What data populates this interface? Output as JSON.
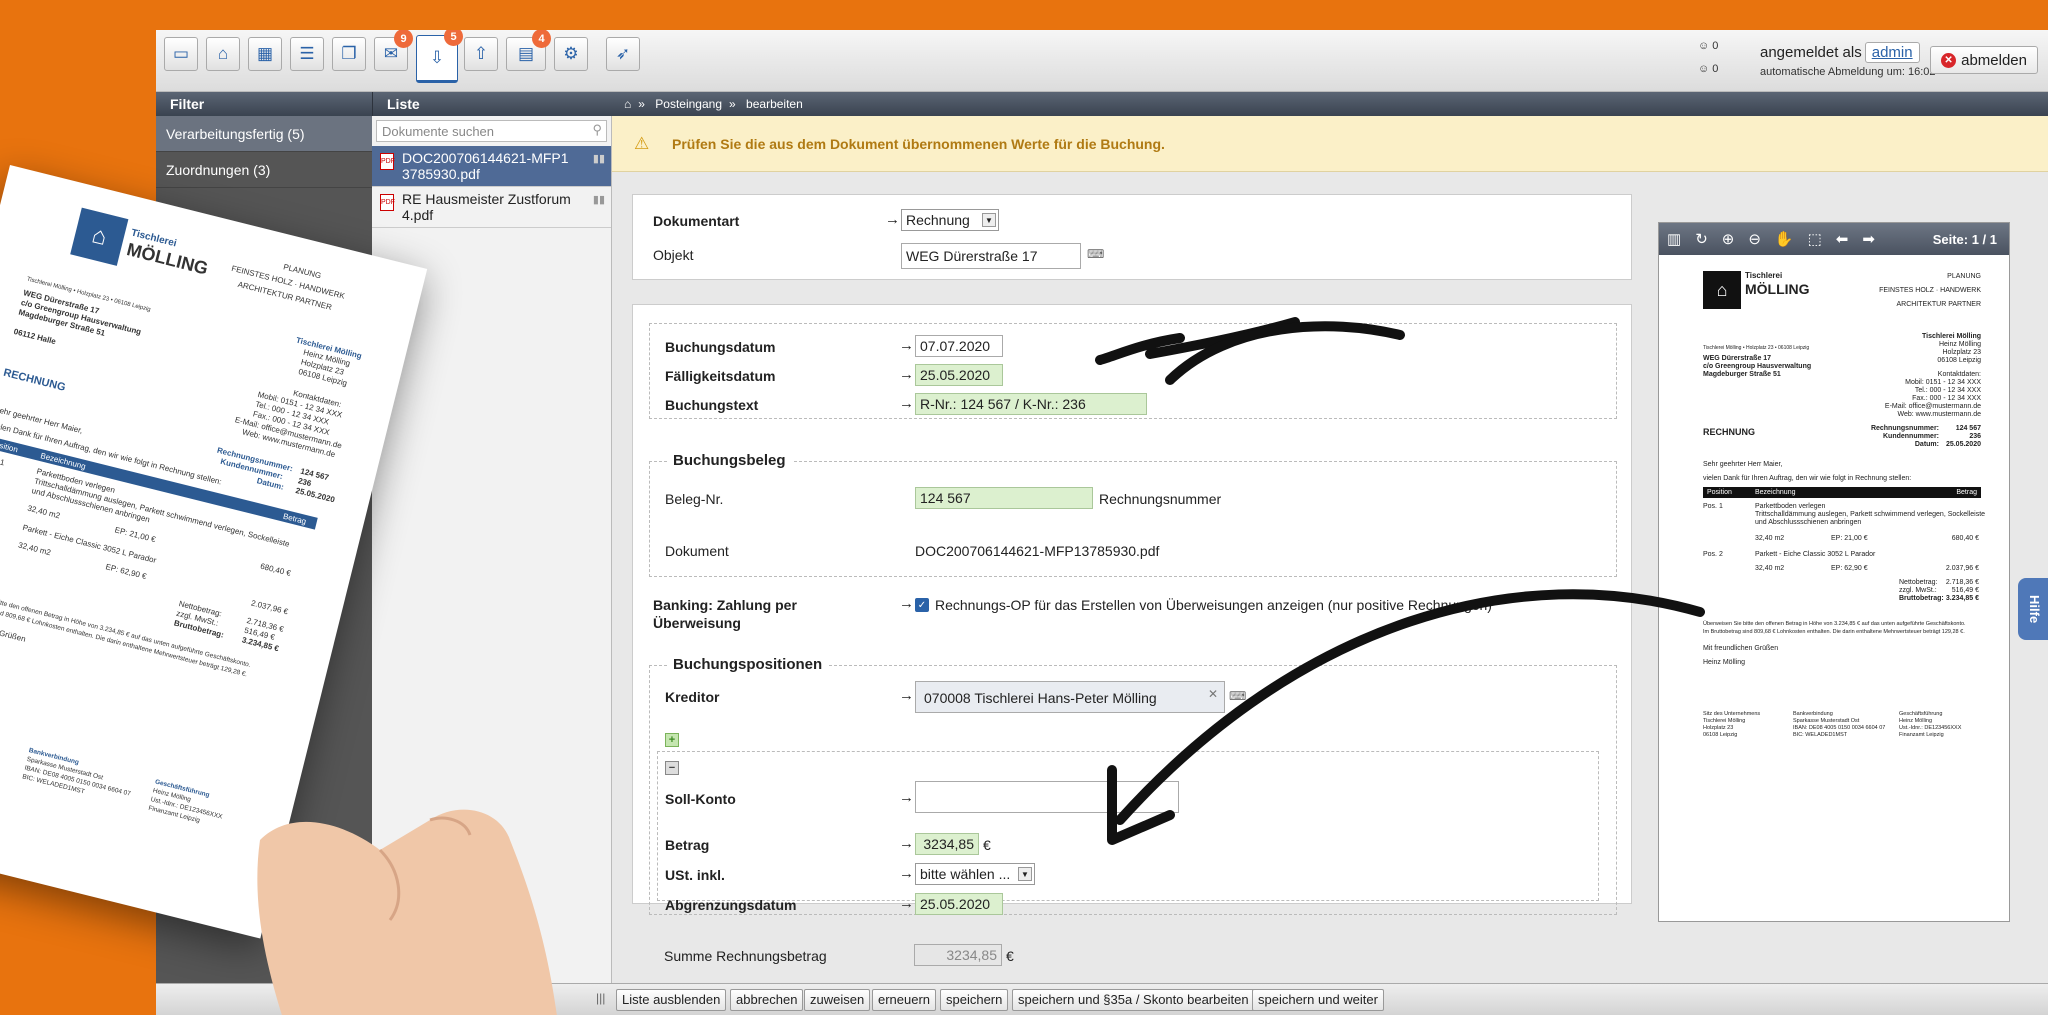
{
  "toolbar": {
    "buttons": [
      {
        "icon": "card-icon",
        "badge": ""
      },
      {
        "icon": "home-icon",
        "badge": ""
      },
      {
        "icon": "calendar-icon",
        "badge": ""
      },
      {
        "icon": "list-icon",
        "badge": ""
      },
      {
        "icon": "documents-icon",
        "badge": ""
      },
      {
        "icon": "mail-icon",
        "badge": "9"
      },
      {
        "icon": "inbox-icon",
        "badge": "5"
      },
      {
        "icon": "outbox-icon",
        "badge": "4"
      },
      {
        "icon": "ticket-icon",
        "badge": ""
      },
      {
        "icon": "gear-icon",
        "badge": ""
      },
      {
        "icon": "rocket-icon",
        "badge": ""
      }
    ],
    "user": {
      "count1": "0",
      "count2": "0",
      "logged_in_as": "angemeldet als",
      "username": "admin",
      "auto_logout": "automatische Abmeldung um: 16:02",
      "logout_label": "abmelden"
    }
  },
  "filter": {
    "title": "Filter",
    "items": [
      "Verarbeitungsfertig (5)",
      "Zuordnungen (3)",
      "",
      ""
    ]
  },
  "list": {
    "title": "Liste",
    "search_placeholder": "Dokumente suchen",
    "items": [
      {
        "name": "DOC200706144621-MFP13785930.pdf",
        "selected": true
      },
      {
        "name": "RE Hausmeister Zustforum 4.pdf",
        "selected": false
      }
    ]
  },
  "breadcrumb": [
    "Posteingang",
    "bearbeiten"
  ],
  "alert": "Prüfen Sie die aus dem Dokument übernommenen Werte für die Buchung.",
  "form": {
    "dokumentart_label": "Dokumentart",
    "dokumentart_value": "Rechnung",
    "objekt_label": "Objekt",
    "objekt_value": "WEG Dürerstraße 17",
    "buchungsdatum_label": "Buchungsdatum",
    "buchungsdatum_value": "07.07.2020",
    "faelligkeit_label": "Fälligkeitsdatum",
    "faelligkeit_value": "25.05.2020",
    "buchungstext_label": "Buchungstext",
    "buchungstext_value": "R-Nr.: 124 567 / K-Nr.: 236",
    "beleg_title": "Buchungsbeleg",
    "beleg_nr_label": "Beleg-Nr.",
    "beleg_nr_value": "124 567",
    "beleg_nr_hint": "Rechnungsnummer",
    "dokument_label": "Dokument",
    "dokument_value": "DOC200706144621-MFP13785930.pdf",
    "banking_label": "Banking: Zahlung per Überweisung",
    "banking_text": "Rechnungs-OP für das Erstellen von Überweisungen anzeigen (nur positive Rechnungen)",
    "positionen_title": "Buchungspositionen",
    "kreditor_label": "Kreditor",
    "kreditor_value": "070008 Tischlerei Hans-Peter Mölling",
    "soll_label": "Soll-Konto",
    "soll_value": "",
    "betrag_label": "Betrag",
    "betrag_value": "3234,85",
    "currency": "€",
    "ust_label": "USt. inkl.",
    "ust_value": "bitte wählen ...",
    "abgrenzung_label": "Abgrenzungsdatum",
    "abgrenzung_value": "25.05.2020",
    "summe_label": "Summe Rechnungsbetrag",
    "summe_value": "3234,85"
  },
  "pdf": {
    "page": "Seite: 1 / 1",
    "company_top": "Tischlerei",
    "company": "MÖLLING",
    "tagline1": "PLANUNG",
    "tagline2": "FEINSTES HOLZ · HANDWERK",
    "tagline3": "ARCHITEKTUR PARTNER",
    "sender_line": "Tischlerei Mölling • Holzplatz 23 • 06108 Leipzig",
    "recipient1": "WEG Dürerstraße 17",
    "recipient2": "c/o Greengroup Hausverwaltung",
    "recipient3": "Magdeburger Straße 51",
    "recipient4": "06112 Halle",
    "contact1": "Tischlerei Mölling",
    "contact2": "Heinz Mölling",
    "contact3": "Holzplatz 23",
    "contact4": "06108 Leipzig",
    "contact5": "Kontaktdaten:",
    "contact6": "Mobil: 0151 - 12 34 XXX",
    "contact7": "Tel.: 000 - 12 34 XXX",
    "contact8": "Fax.: 000 - 12 34 XXX",
    "contact9": "E-Mail: office@mustermann.de",
    "contact10": "Web: www.mustermann.de",
    "doc_title": "RECHNUNG",
    "meta1_label": "Rechnungsnummer:",
    "meta1_value": "124 567",
    "meta2_label": "Kundennummer:",
    "meta2_value": "236",
    "meta3_label": "Datum:",
    "meta3_value": "25.05.2020",
    "greeting": "Sehr geehrter Herr Maier,",
    "intro": "vielen Dank für Ihren Auftrag, den wir wie folgt in Rechnung stellen:",
    "th_pos": "Position",
    "th_desc": "Bezeichnung",
    "th_amount": "Betrag",
    "pos1": "Pos. 1",
    "pos1_desc1": "Parkettboden verlegen",
    "pos1_desc2": "Trittschalldämmung auslegen, Parkett schwimmend verlegen, Sockelleiste",
    "pos1_desc3": "und Abschlussschienen anbringen",
    "pos1_qty": "32,40 m2",
    "pos1_ep": "EP: 21,00 €",
    "pos1_sum": "680,40 €",
    "pos2": "Pos. 2",
    "pos2_desc": "Parkett - Eiche Classic 3052 L Parador",
    "pos2_qty": "32,40 m2",
    "pos2_ep": "EP: 62,90 €",
    "pos2_sum": "2.037,96 €",
    "netto_label": "Nettobetrag:",
    "netto_value": "2.718,36 €",
    "mwst_label": "zzgl. MwSt.:",
    "mwst_value": "516,49 €",
    "brutto_label": "Bruttobetrag:",
    "brutto_value": "3.234,85 €",
    "closing1": "Überweisen Sie bitte den offenen Betrag in Höhe von 3.234,85 € auf das unten aufgeführte Geschäftskonto.",
    "closing2": "Im Bruttobetrag sind 809,68 € Lohnkosten enthalten. Die darin enthaltene Mehrwertsteuer beträgt 129,28 €.",
    "regards": "Mit freundlichen Grüßen",
    "signature": "Heinz Mölling",
    "foot1a": "Sitz des Unternehmens",
    "foot1b": "Tischlerei Mölling",
    "foot1c": "Holzplatz 23",
    "foot1d": "06108 Leipzig",
    "foot2a": "Bankverbindung",
    "foot2b": "Sparkasse Musterstadt Ost",
    "foot2c": "IBAN: DE08 4005 0150 0034 6604 07",
    "foot2d": "BIC: WELADED1MST",
    "foot3a": "Geschäftsführung",
    "foot3b": "Heinz Mölling",
    "foot3c": "Ust.-Idnr.: DE123456XXX",
    "foot3d": "Finanzamt Leipzig"
  },
  "help": "Hilfe",
  "bottom_buttons": [
    "Liste ausblenden",
    "abbrechen",
    "zuweisen",
    "erneuern",
    "speichern",
    "speichern und §35a / Skonto bearbeiten",
    "speichern und weiter"
  ],
  "colors": {
    "accent": "#2a62a8",
    "background": "#e8730e",
    "alert_bg": "#fbf0c8",
    "green_field": "#dcf0cf"
  }
}
